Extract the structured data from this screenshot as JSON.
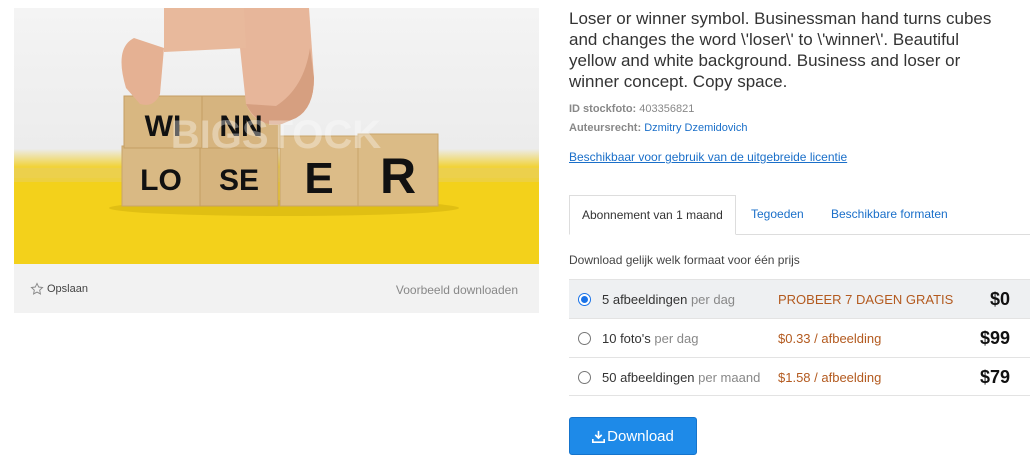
{
  "image": {
    "cube_top_letters": [
      "WI",
      "NN"
    ],
    "cube_bottom_letters": [
      "LO",
      "SE",
      "E",
      "R"
    ],
    "watermark": "BIGSTOCK"
  },
  "actions": {
    "save_label": "Opslaan",
    "preview_label": "Voorbeeld downloaden"
  },
  "details": {
    "title": "Loser or winner symbol. Businessman hand turns cubes and changes the word \\'loser\\' to \\'winner\\'. Beautiful yellow and white background. Business and loser or winner concept. Copy space.",
    "id_label": "ID stockfoto:",
    "id_value": "403356821",
    "author_label": "Auteursrecht:",
    "author_value": "Dzmitry Dzemidovich",
    "license_link": "Beschikbaar voor gebruik van de uitgebreide licentie"
  },
  "tabs": [
    "Abonnement van 1 maand",
    "Tegoeden",
    "Beschikbare formaten"
  ],
  "subtitle": "Download gelijk welk formaat voor één prijs",
  "plans": [
    {
      "count": "5 afbeeldingen",
      "period": "per dag",
      "price": "PROBEER 7 DAGEN GRATIS",
      "amount": "$0",
      "selected": true
    },
    {
      "count": "10 foto's",
      "period": "per dag",
      "price": "$0.33 / afbeelding",
      "amount": "$99",
      "selected": false
    },
    {
      "count": "50 afbeeldingen",
      "period": "per maand",
      "price": "$1.58 / afbeelding",
      "amount": "$79",
      "selected": false
    }
  ],
  "download_label": "Download",
  "colors": {
    "accent": "#1e8ae8",
    "price": "#b35a1f",
    "link": "#1a6fc9"
  },
  "icons": {
    "save": "star-outline-icon",
    "download": "download-icon"
  }
}
